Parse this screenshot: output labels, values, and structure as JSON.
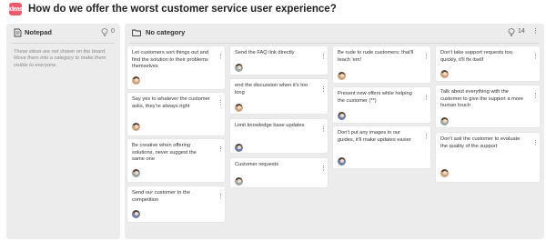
{
  "board": {
    "logo_text": "ideas",
    "title": "How do we offer the worst customer service user experience?"
  },
  "notepad": {
    "title": "Notepad",
    "count": "0",
    "hint": "These ideas are not shown on the board. Move them into a category to make them visible to everyone."
  },
  "category": {
    "title": "No category",
    "count": "14"
  },
  "cards": [
    {
      "text": "Let customers sort things out and find the solution to their problems themselves",
      "avatar": "av-a"
    },
    {
      "text": "Say yes to whatever the customer asks, they're always right",
      "avatar": "av-a"
    },
    {
      "text": "Be creative when offering solutions, never suggest the same one",
      "avatar": "av-c"
    },
    {
      "text": "Send our customer to the competition",
      "avatar": "av-b"
    },
    {
      "text": "Send the FAQ link directly",
      "avatar": "av-c"
    },
    {
      "text": "end the discussion when it's too long",
      "avatar": "av-a"
    },
    {
      "text": "Limit knowledge base updates",
      "avatar": "av-b"
    },
    {
      "text": "Customer requests",
      "avatar": "av-c"
    },
    {
      "text": "Be rude to rude customers: that'll teach 'em!",
      "avatar": "av-a"
    },
    {
      "text": "Present new offers while helping the customer (**)",
      "avatar": "av-b"
    },
    {
      "text": "Don't put any images in our guides, it'll make updates easier",
      "avatar": "av-b"
    },
    {
      "text": "Don't take support requests too quickly, it'll fix itself",
      "avatar": "av-a"
    },
    {
      "text": "Talk about everything with the customer to give the support a more human touch",
      "avatar": "av-c"
    },
    {
      "text": "Don't ask the customer to evaluate the quality of the support",
      "avatar": "av-a"
    }
  ],
  "colors": {
    "accent": "#ef5a6b",
    "panel": "#ececec",
    "card": "#ffffff"
  }
}
